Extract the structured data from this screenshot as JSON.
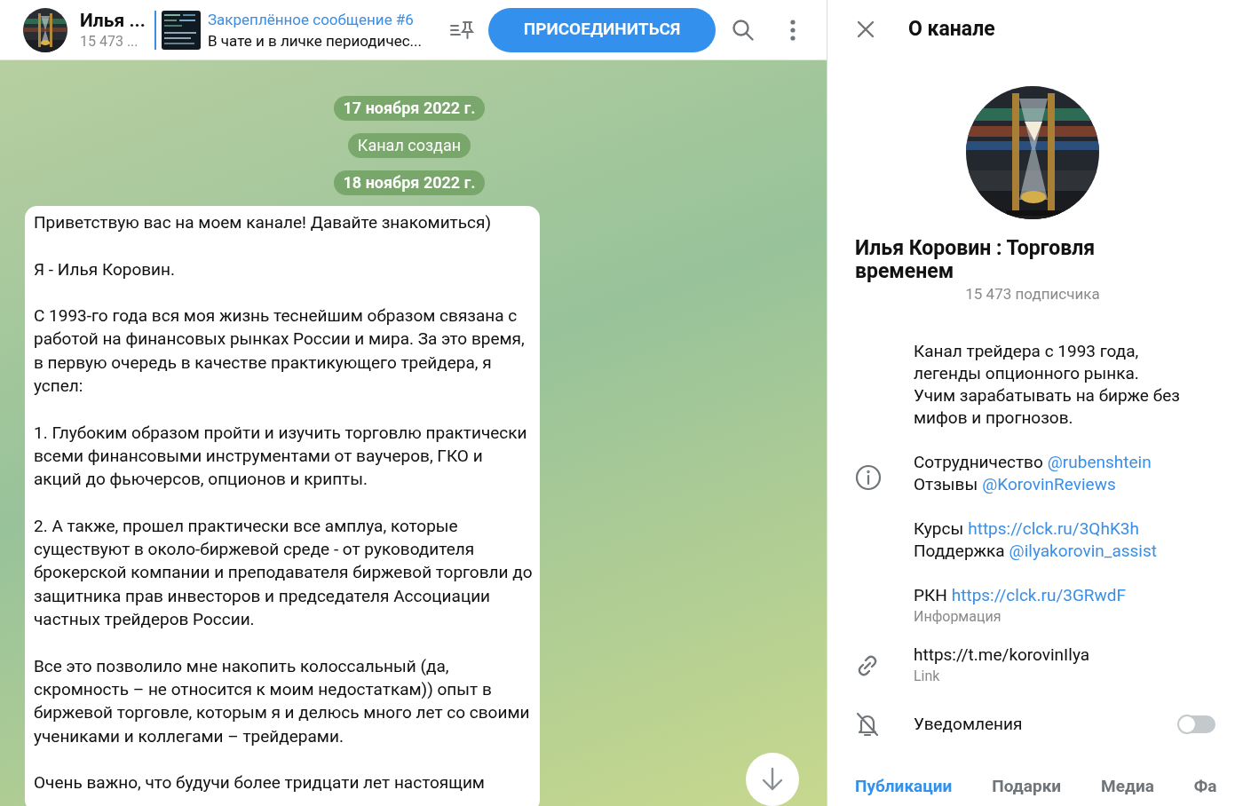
{
  "header": {
    "title": "Илья ...",
    "subtitle": "15 473 ...",
    "pinned": {
      "title": "Закреплённое сообщение #6",
      "text": "В чате и в личке периодичес..."
    },
    "join_button": "ПРИСОЕДИНИТЬСЯ"
  },
  "chat": {
    "service": [
      {
        "kind": "date",
        "text": "17 ноября 2022 г."
      },
      {
        "kind": "service",
        "text": "Канал создан"
      },
      {
        "kind": "date",
        "text": "18 ноября 2022 г."
      }
    ],
    "message": {
      "paragraphs": [
        "Приветствую вас на моем канале! Давайте знакомиться)",
        "Я - Илья Коровин.",
        "С 1993-го года вся моя жизнь теснейшим образом связана с работой на финансовых рынках России и мира. За это время, в первую очередь в качестве практикующего трейдера, я успел:",
        "1. Глубоким образом пройти и изучить торговлю практически всеми финансовыми инструментами от ваучеров, ГКО и акций до фьючерсов, опционов и крипты.",
        "2. А также, прошел практически все амплуа, которые существуют в около-биржевой среде - от руководителя брокерской компании и преподавателя биржевой торговли до защитника прав инвесторов и председателя Ассоциации частных трейдеров России.",
        "Все это позволило мне накопить колоссальный (да, скромность – не относится к моим недостаткам))  опыт в биржевой торговле, которым я и делюсь много лет со своими учениками и коллегами – трейдерами.",
        "Очень важно, что будучи более тридцати лет настоящим"
      ]
    }
  },
  "panel": {
    "title": "О канале",
    "name": "Илья Коровин : Торговля временем",
    "subscribers": "15 473 подписчика",
    "description": "Канал трейдера с 1993 года,\nлегенды опционного рынка.\nУчим зарабатывать на бирже без мифов и прогнозов.",
    "groups": [
      [
        {
          "label": "Сотрудничество",
          "link": "@rubenshtein"
        },
        {
          "label": "Отзывы",
          "link": "@KorovinReviews"
        }
      ],
      [
        {
          "label": "Курсы",
          "link": "https://clck.ru/3QhK3h"
        },
        {
          "label": "Поддержка",
          "link": "@ilyakorovin_assist"
        }
      ],
      [
        {
          "label": "РКН",
          "link": "https://clck.ru/3GRwdF"
        }
      ]
    ],
    "info_caption": "Информация",
    "link": {
      "url": "https://t.me/korovinIlya",
      "caption": "Link"
    },
    "notifications": {
      "label": "Уведомления",
      "on": false
    },
    "tabs": [
      {
        "label": "Публикации",
        "selected": true
      },
      {
        "label": "Подарки",
        "selected": false
      },
      {
        "label": "Медиа",
        "selected": false
      },
      {
        "label": "Фа",
        "selected": false
      }
    ]
  }
}
